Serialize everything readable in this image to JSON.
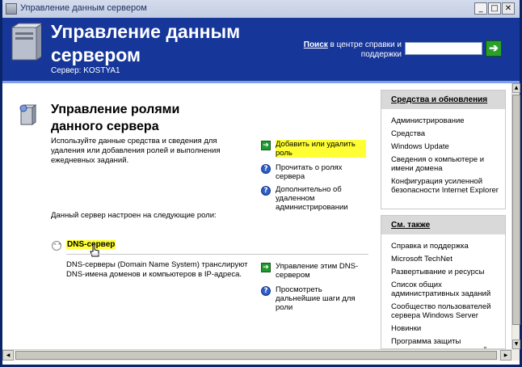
{
  "window": {
    "title": "Управление данным сервером",
    "buttons": {
      "minimize": "_",
      "maximize": "□",
      "close": "✕"
    }
  },
  "header": {
    "title": "Управление данным сервером",
    "server_label": "Сервер: KOSTYA1",
    "search_bold": "Поиск",
    "search_rest": " в центре справки и поддержки",
    "search_value": "",
    "go_glyph": "➔"
  },
  "roles": {
    "title": "Управление ролями данного сервера",
    "intro": "Используйте данные средства и сведения для удаления или добавления ролей и выполнения ежедневных заданий.",
    "actions": [
      {
        "icon": "arrow-icon",
        "label": "Добавить или удалить роль",
        "highlighted": true
      },
      {
        "icon": "help-icon",
        "label": "Прочитать о ролях сервера"
      },
      {
        "icon": "help-icon",
        "label": "Дополнительно об удаленном администрировании"
      }
    ],
    "status": "Данный сервер настроен на следующие роли:"
  },
  "dns": {
    "title": "DNS-сервер",
    "description": "DNS-серверы (Domain Name System) транслируют DNS-имена доменов и компьютеров в IP-адреса.",
    "actions": [
      {
        "icon": "arrow-icon",
        "label": "Управление этим DNS-сервером"
      },
      {
        "icon": "help-icon",
        "label": "Просмотреть дальнейшие шаги для роли"
      }
    ]
  },
  "tools_panel": {
    "title": "Средства и обновления",
    "items": [
      "Администрирование",
      "Средства",
      "Windows Update",
      "Сведения о компьютере и имени домена",
      "Конфигурация усиленной безопасности Internet Explorer"
    ]
  },
  "see_also_panel": {
    "title": "См. также",
    "items": [
      "Справка и поддержка",
      "Microsoft TechNet",
      "Развертывание и ресурсы",
      "Список общих административных заданий",
      "Сообщество пользователей сервера Windows Server",
      "Новинки",
      "Программа защиты стратегических технологий"
    ]
  },
  "icon_glyphs": {
    "arrow": "➔",
    "help": "?",
    "collapse": "⌃⌃",
    "scroll_up": "▲",
    "scroll_down": "▼",
    "scroll_left": "◀",
    "scroll_right": "▶"
  },
  "colors": {
    "header_bg": "#16369a",
    "highlight": "#ffff33",
    "panel_header": "#d9d9d9"
  }
}
